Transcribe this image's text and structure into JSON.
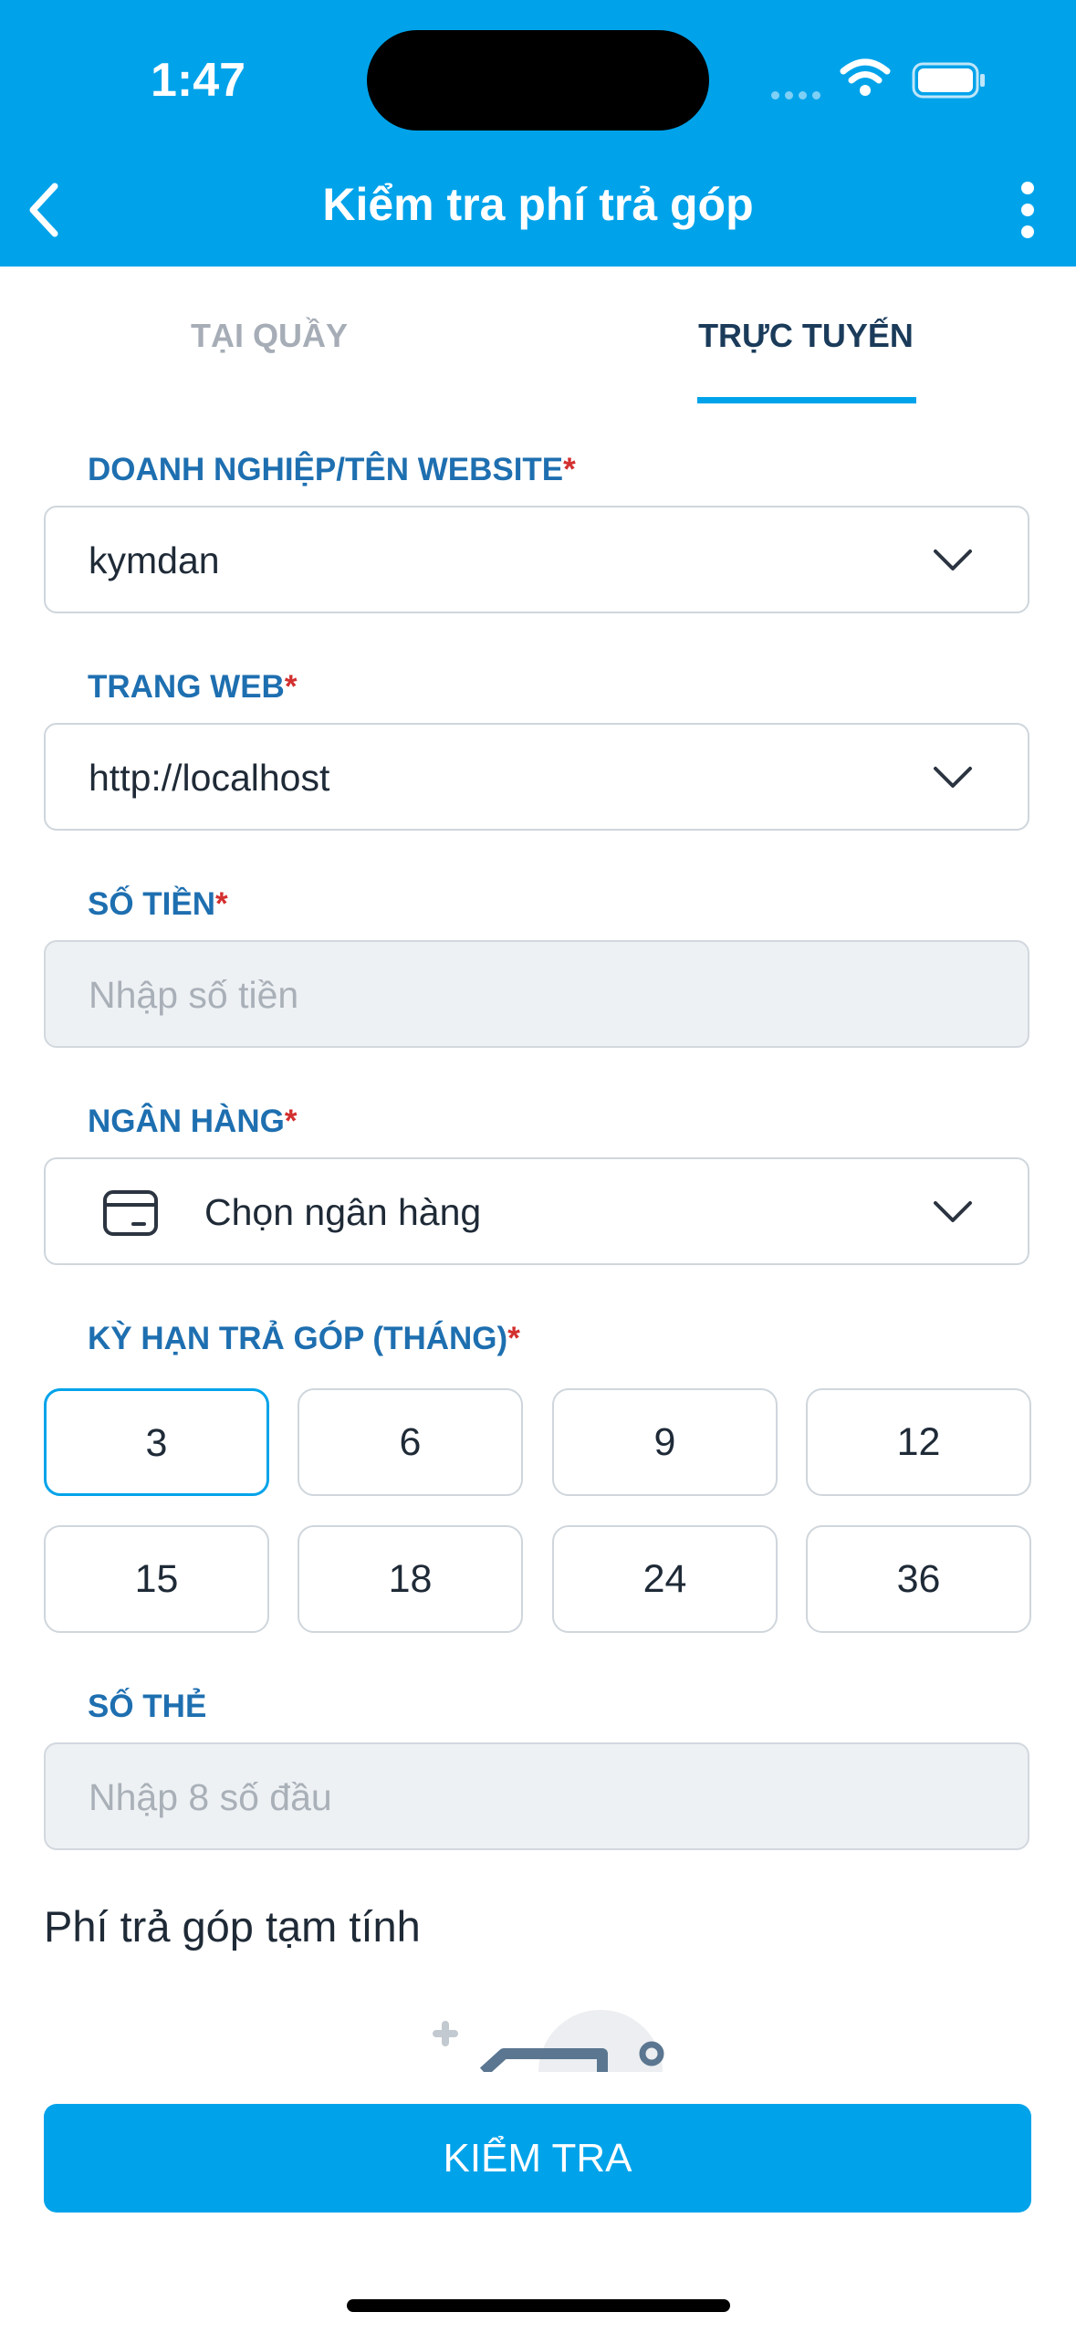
{
  "status": {
    "time": "1:47"
  },
  "header": {
    "title": "Kiểm tra phí trả góp"
  },
  "tabs": [
    {
      "label": "TẠI QUẦY",
      "active": false
    },
    {
      "label": "TRỰC TUYẾN",
      "active": true
    }
  ],
  "form": {
    "business": {
      "label": "DOANH NGHIỆP/TÊN WEBSITE",
      "required": "*",
      "value": "kymdan"
    },
    "website": {
      "label": "TRANG WEB",
      "required": "*",
      "value": "http://localhost"
    },
    "amount": {
      "label": "SỐ TIỀN",
      "required": "*",
      "placeholder": "Nhập số tiền"
    },
    "bank": {
      "label": "NGÂN HÀNG",
      "required": "*",
      "value": "Chọn ngân hàng"
    },
    "term": {
      "label": "KỲ HẠN TRẢ GÓP (THÁNG)",
      "required": "*",
      "options": [
        "3",
        "6",
        "9",
        "12",
        "15",
        "18",
        "24",
        "36"
      ],
      "selected": "3"
    },
    "card": {
      "label": "SỐ THẺ",
      "placeholder": "Nhập 8 số đầu"
    }
  },
  "result": {
    "title": "Phí trả góp tạm tính"
  },
  "actions": {
    "check_label": "KIỂM TRA"
  },
  "colors": {
    "primary": "#00a3ea",
    "label": "#1e6fb0",
    "required": "#d32f2f"
  }
}
